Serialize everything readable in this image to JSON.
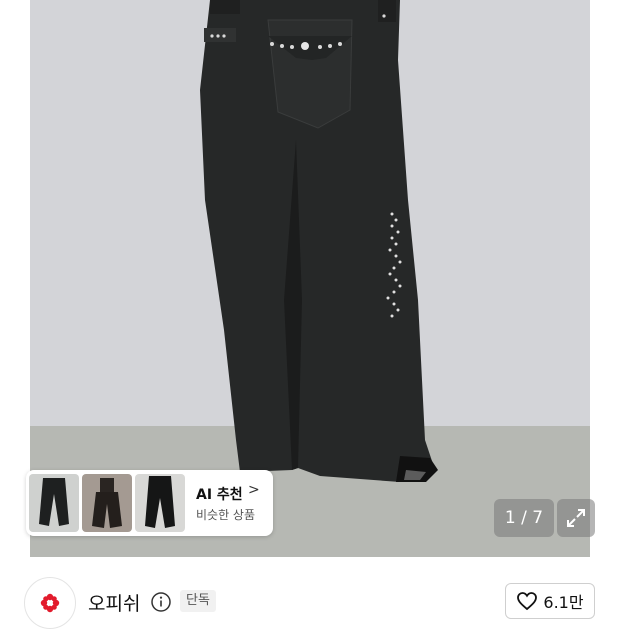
{
  "gallery": {
    "counter_current": "1",
    "counter_sep": "/",
    "counter_total": "7",
    "counter_text": "1 / 7",
    "expand_icon": "expand-icon"
  },
  "ai_recommend": {
    "title": "AI 추천",
    "chevron": ">",
    "subtitle": "비슷한 상품"
  },
  "brand": {
    "name": "오피쉬",
    "info_icon": "info-icon",
    "badge": "단독",
    "logo_icon": "flower-logo-icon",
    "logo_color": "#e21b2c"
  },
  "like": {
    "icon": "heart-icon",
    "count": "6.1만"
  }
}
